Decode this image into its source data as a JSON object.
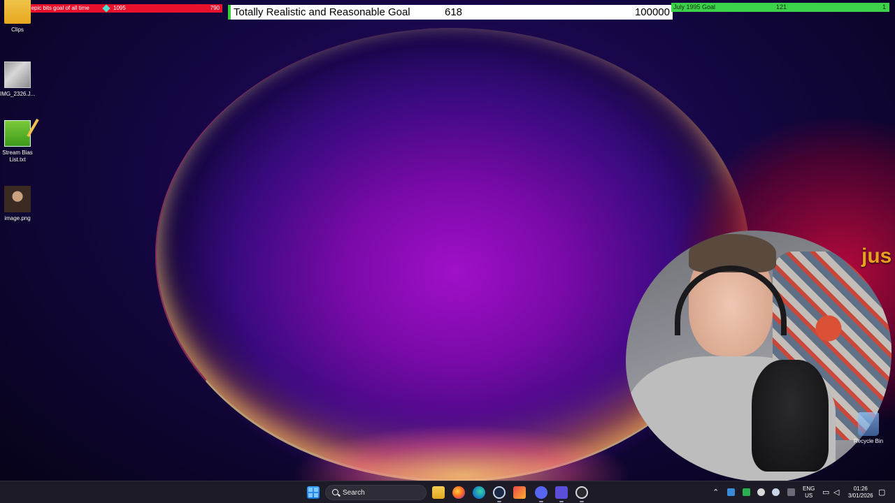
{
  "goals": {
    "epic_bits": {
      "title": "The most epic bits goal of all time",
      "current": "1095",
      "target": "790"
    },
    "main": {
      "title": "Totally Realistic and Reasonable Goal",
      "current": "618",
      "target": "100000"
    },
    "july": {
      "title": "July 1995 Goal",
      "current": "121",
      "target": "1"
    }
  },
  "desktop_icons": [
    {
      "label": "Clips"
    },
    {
      "label": "IMG_2326.J..."
    },
    {
      "label": "Stream Bias List.txt"
    },
    {
      "label": "image.png"
    }
  ],
  "overlay_text": "jus",
  "recycle_bin": {
    "label": "Recycle Bin"
  },
  "taskbar": {
    "search_placeholder": "Search",
    "language": {
      "line1": "ENG",
      "line2": "US"
    },
    "clock": {
      "time": "01:26",
      "date": "3/01/2026"
    }
  }
}
